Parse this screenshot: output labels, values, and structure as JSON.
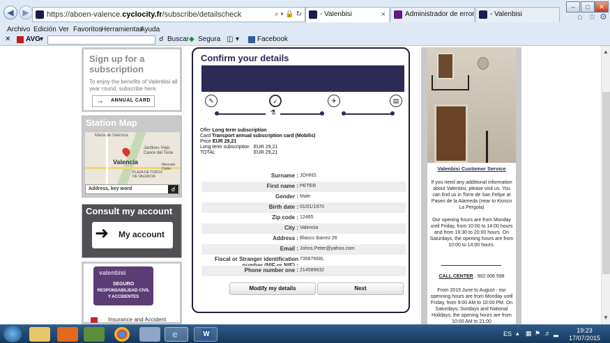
{
  "browser": {
    "url_prefix": "https://aboen-valence.",
    "url_domain": "cyclocity.fr",
    "url_path": "/subscribe/detailscheck",
    "url_controls": "⌕ ▾ 🔒 ↻",
    "tabs": [
      {
        "label": "- Valenbisi",
        "close": "×"
      },
      {
        "label": "Administrador de errores de ...",
        "close": ""
      },
      {
        "label": "- Valenbisi",
        "close": ""
      }
    ],
    "menu": [
      "Archivo",
      "Edición",
      "Ver",
      "Favoritos",
      "Herramientas",
      "Ayuda"
    ],
    "toolbar": {
      "avg": "AVG",
      "search_btn": "Buscar",
      "safe": "Segura",
      "facebook": "Facebook"
    }
  },
  "left": {
    "signup_title": "Sign up for a subscription",
    "signup_text": "To enjoy the benefits of Valenbisi all year round, subscribe here.",
    "annual_card_btn": "ANNUAL CARD",
    "station_map_title": "Station Map",
    "map_labels": [
      "Maria de Valencia",
      "Valencia",
      "Jardines Viejo Cauce del Turia",
      "PLAZA DE TOROS DE VALENCIA",
      "Mercado Colón"
    ],
    "address_placeholder": "Address, key word",
    "consult_title": "Consult my account",
    "my_account_btn": "My account",
    "valenbisi_brand": "valenbisi",
    "insurance_line1": "SEGURO",
    "insurance_line2": "RESPONSABILIDAD CIVIL",
    "insurance_line3": "Y ACCIDENTES",
    "insurance_caption": "Insurance and Accident"
  },
  "confirm": {
    "title": "Confirm your details",
    "summary": {
      "offer_label": "Offer",
      "offer_value": "Long term subscription",
      "card_label": "Card",
      "card_value": "Transport annual subscription card (Mobilis)",
      "price_label": "Price",
      "price_value": "EUR 29,21",
      "lts_label": "Long term subscription",
      "lts_value": "EUR 29,21",
      "total_label": "TOTAL",
      "total_value": "EUR 29,21"
    },
    "fields": [
      {
        "label": "Surname :",
        "value": "JOHNS"
      },
      {
        "label": "First name :",
        "value": "PETER"
      },
      {
        "label": "Gender :",
        "value": "Male"
      },
      {
        "label": "Birth date :",
        "value": "01/01/1970"
      },
      {
        "label": "Zip code :",
        "value": "12465"
      },
      {
        "label": "City :",
        "value": "Valencia"
      },
      {
        "label": "Address :",
        "value": "Blasco Ibanez 26"
      },
      {
        "label": "Email :",
        "value": "Johns.Peter@yahoo.com"
      }
    ],
    "fiscal_label": "Fiscal or Stranger identification number (NIF or NIE) :",
    "fiscal_value": "73587668L",
    "phone_label": "Phone number one :",
    "phone_value": "214589632",
    "modify_btn": "Modify my details",
    "next_btn": "Next"
  },
  "right": {
    "service_title": "Valenbisi Customer Service",
    "info_text": "If you need any additional information about Valenbisi, please visit us. You can find us in Torre de San Felipe at Paseo de la Alameda (near to Kiosco La Pergola)",
    "hours_text": "Our opening hours are from Monday until Friday, from 10:00 to 14:00 hours and from 16:30 to 20:00 hours. On Saturdays, the opening hours are from 10:00 to 14:00 hours.",
    "call_center_label": "CALL CENTER",
    "call_center_number": ": 902 006 598",
    "summer_text": "From 2015 June to August - our openning hours are from Monday until Friday, from 9:00 AM to 10:00 PM. On Saturdays, Sundays and National Holidays, the opening hours are from 10:00 AM to 21:00"
  },
  "taskbar": {
    "lang": "ES",
    "time": "19:23",
    "date": "17/07/2015"
  }
}
